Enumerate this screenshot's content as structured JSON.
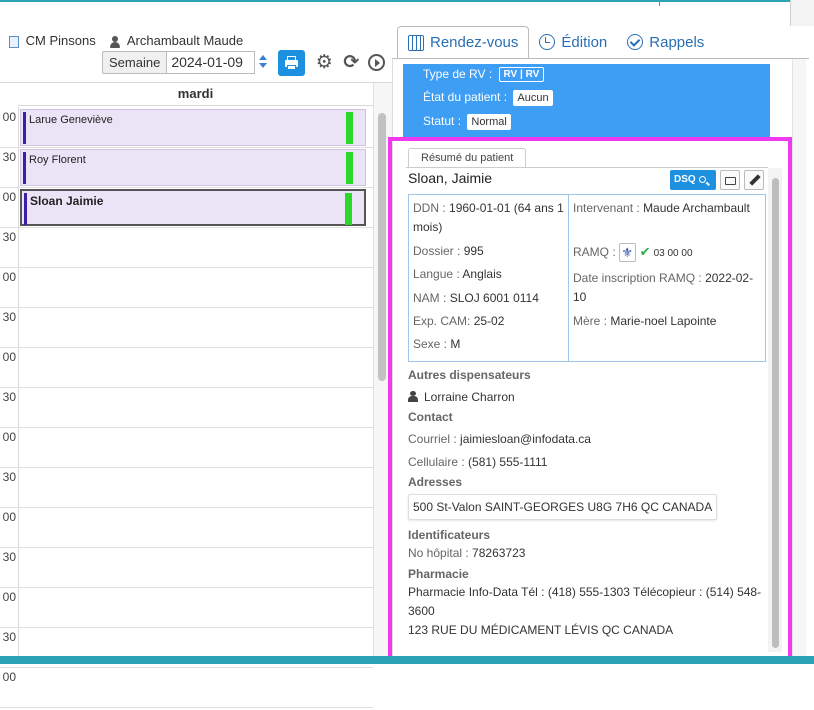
{
  "location": {
    "clinic": "CM Pinsons",
    "practitioner": "Archambault Maude"
  },
  "controls": {
    "week_label": "Semaine",
    "date_value": "2024-01-09"
  },
  "calendar": {
    "day_header": "mardi",
    "time_labels": [
      "00",
      "30",
      "00",
      "30",
      "00",
      "30",
      "00",
      "30",
      "00",
      "30",
      "00",
      "30",
      "00",
      "30",
      "00"
    ],
    "appointments": [
      {
        "name": "Larue Geneviève"
      },
      {
        "name": "Roy Florent"
      },
      {
        "name": "Sloan Jaimie"
      }
    ]
  },
  "tabs": [
    {
      "label": "Rendez-vous",
      "icon": "calendar-icon"
    },
    {
      "label": "Édition",
      "icon": "clock-icon"
    },
    {
      "label": "Rappels",
      "icon": "check-circle-icon"
    }
  ],
  "rv": {
    "type_label": "Type de RV :",
    "type_value": "RV | RV",
    "etat_label": "État du patient :",
    "etat_value": "Aucun",
    "statut_label": "Statut :",
    "statut_value": "Normal"
  },
  "summary": {
    "tab_label": "Résumé du patient",
    "patient_name": "Sloan, Jaimie",
    "dsq_label": "DSQ",
    "left": [
      {
        "label": "DDN :",
        "value": "1960-01-01 (64 ans 1 mois)"
      },
      {
        "label": "Dossier :",
        "value": "995"
      },
      {
        "label": "Langue :",
        "value": "Anglais"
      },
      {
        "label": "NAM :",
        "value": "SLOJ 6001 0114"
      },
      {
        "label": "Exp. CAM:",
        "value": "25-02"
      },
      {
        "label": "Sexe :",
        "value": "M"
      }
    ],
    "intervenant_label": "Intervenant :",
    "intervenant_value": "Maude Archambault",
    "ramq_label": "RAMQ :",
    "ramq_num": "03 00 00",
    "inscription_label": "Date inscription RAMQ :",
    "inscription_value": "2022-02-10",
    "mere_label": "Mère :",
    "mere_value": "Marie-noel Lapointe",
    "dispensateurs_title": "Autres dispensateurs",
    "dispensateur": "Lorraine Charron",
    "contact_title": "Contact",
    "courriel_label": "Courriel :",
    "courriel_value": "jaimiesloan@infodata.ca",
    "cellulaire_label": "Cellulaire :",
    "cellulaire_value": "(581) 555-1111",
    "adresses_title": "Adresses",
    "adresse": "500 St-Valon SAINT-GEORGES U8G 7H6 QC CANADA",
    "identificateurs_title": "Identificateurs",
    "hopital_label": "No hôpital :",
    "hopital_value": "78263723",
    "pharmacie_title": "Pharmacie",
    "pharmacie_line1": "Pharmacie Info-Data Tél : (418) 555-1303 Télécopieur : (514) 548-3600",
    "pharmacie_line2": "123 RUE DU MÉDICAMENT LÉVIS QC CANADA"
  },
  "colors": {
    "accent": "#1e90e0",
    "rv_panel": "#3e9ef4",
    "highlight": "#f03af0",
    "appointment_bg": "#ebe4f7",
    "confirmed": "#2ad82a"
  }
}
